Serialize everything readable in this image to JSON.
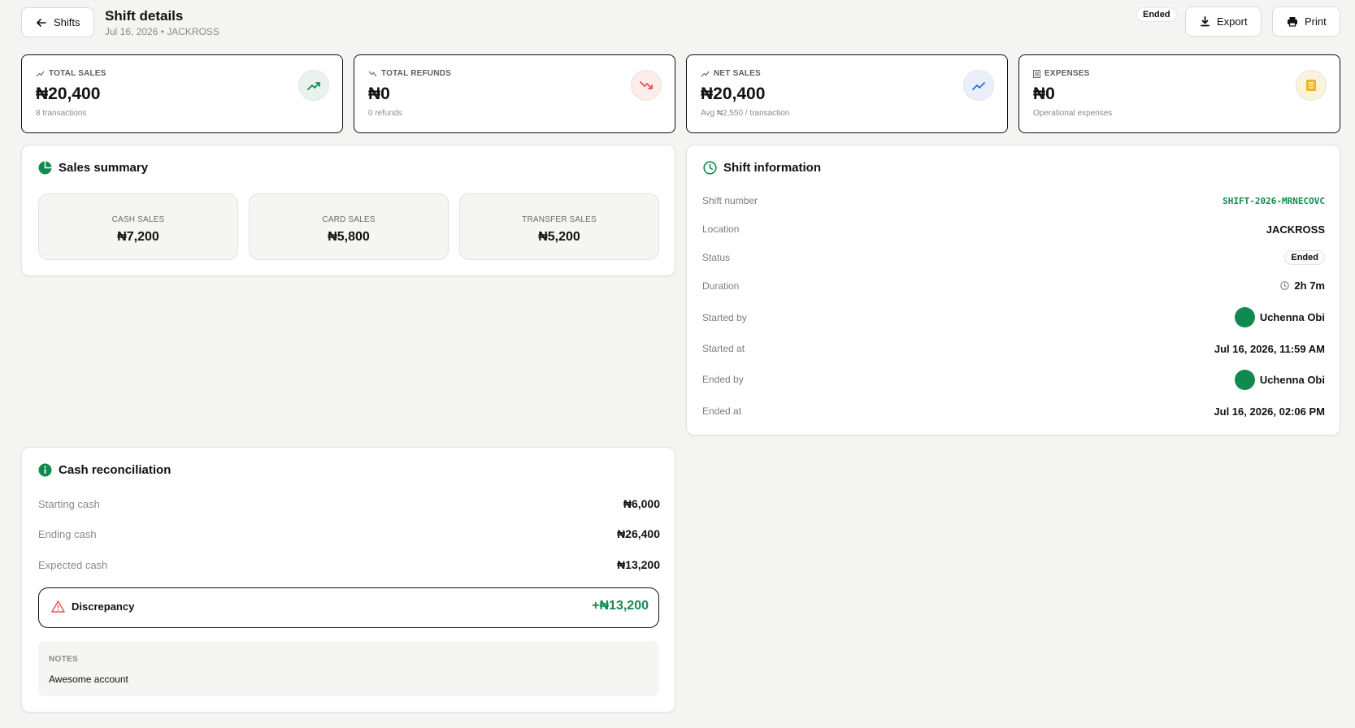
{
  "header": {
    "back_label": "Shifts",
    "title": "Shift details",
    "subtitle": "Jul 16, 2026 • JACKROSS",
    "status_badge": "Ended",
    "export_label": "Export",
    "print_label": "Print"
  },
  "stats": [
    {
      "label": "TOTAL SALES",
      "value": "₦20,400",
      "sub": "8 transactions",
      "icon": "trending-up-icon",
      "color": "#118a4f"
    },
    {
      "label": "TOTAL REFUNDS",
      "value": "₦0",
      "sub": "0 refunds",
      "icon": "trending-down-icon",
      "color": "#e5534b"
    },
    {
      "label": "NET SALES",
      "value": "₦20,400",
      "sub": "Avg ₦2,550 / transaction",
      "icon": "trending-up-icon",
      "color": "#2f6fd1"
    },
    {
      "label": "EXPENSES",
      "value": "₦0",
      "sub": "Operational expenses",
      "icon": "receipt-icon",
      "color": "#f0b429"
    }
  ],
  "sales_summary": {
    "title": "Sales summary",
    "tiles": [
      {
        "label": "CASH SALES",
        "value": "₦7,200"
      },
      {
        "label": "CARD SALES",
        "value": "₦5,800"
      },
      {
        "label": "TRANSFER SALES",
        "value": "₦5,200"
      }
    ]
  },
  "shift_info": {
    "title": "Shift information",
    "shift_number_label": "Shift number",
    "shift_number": "SHIFT-2026-MRNECOVC",
    "location_label": "Location",
    "location": "JACKROSS",
    "status_label": "Status",
    "status": "Ended",
    "duration_label": "Duration",
    "duration": "2h 7m",
    "started_by_label": "Started by",
    "started_by": "Uchenna Obi",
    "started_at_label": "Started at",
    "started_at": "Jul 16, 2026, 11:59 AM",
    "ended_by_label": "Ended by",
    "ended_by": "Uchenna Obi",
    "ended_at_label": "Ended at",
    "ended_at": "Jul 16, 2026, 02:06 PM"
  },
  "reconciliation": {
    "title": "Cash reconciliation",
    "starting_label": "Starting cash",
    "starting_value": "₦6,000",
    "ending_label": "Ending cash",
    "ending_value": "₦26,400",
    "expected_label": "Expected cash",
    "expected_value": "₦13,200",
    "discrepancy_label": "Discrepancy",
    "discrepancy_value": "+₦13,200",
    "notes_label": "NOTES",
    "notes_text": "Awesome account"
  },
  "colors": {
    "accent": "#118a4f",
    "warning": "#e5534b"
  }
}
